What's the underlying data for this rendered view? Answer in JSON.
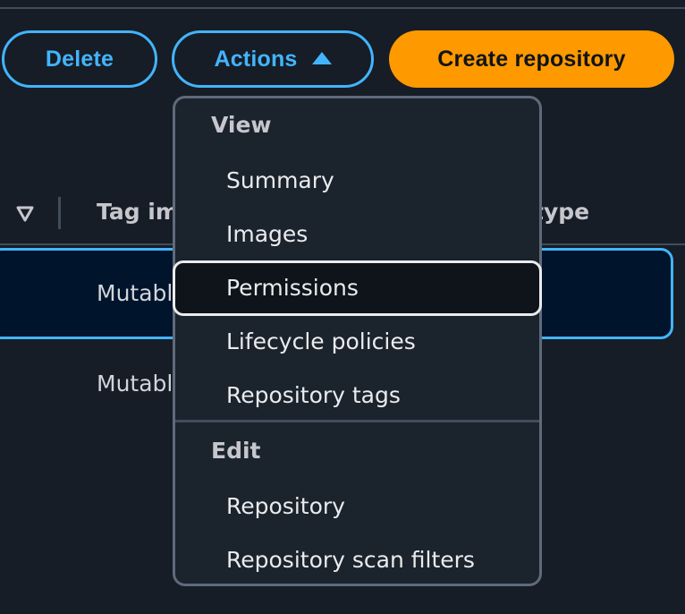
{
  "toolbar": {
    "delete_label": "Delete",
    "actions_label": "Actions",
    "create_label": "Create repository"
  },
  "table": {
    "headers": [
      "Tag im",
      "type"
    ],
    "rows": [
      {
        "tag_immutability": "Mutabl",
        "selected": true
      },
      {
        "tag_immutability": "Mutabl",
        "selected": false
      }
    ]
  },
  "actions_menu": {
    "groups": [
      {
        "title": "View",
        "items": [
          "Summary",
          "Images",
          "Permissions",
          "Lifecycle policies",
          "Repository tags"
        ]
      },
      {
        "title": "Edit",
        "items": [
          "Repository",
          "Repository scan filters"
        ]
      }
    ],
    "highlighted_item": "Permissions"
  },
  "colors": {
    "background": "#161d26",
    "accent_blue": "#42b4ff",
    "primary_orange": "#ff9900",
    "menu_bg": "#1b232d",
    "selected_row_bg": "#00142b"
  },
  "icons": {
    "sort": "sort-descending-icon",
    "actions_caret": "caret-up-icon"
  }
}
